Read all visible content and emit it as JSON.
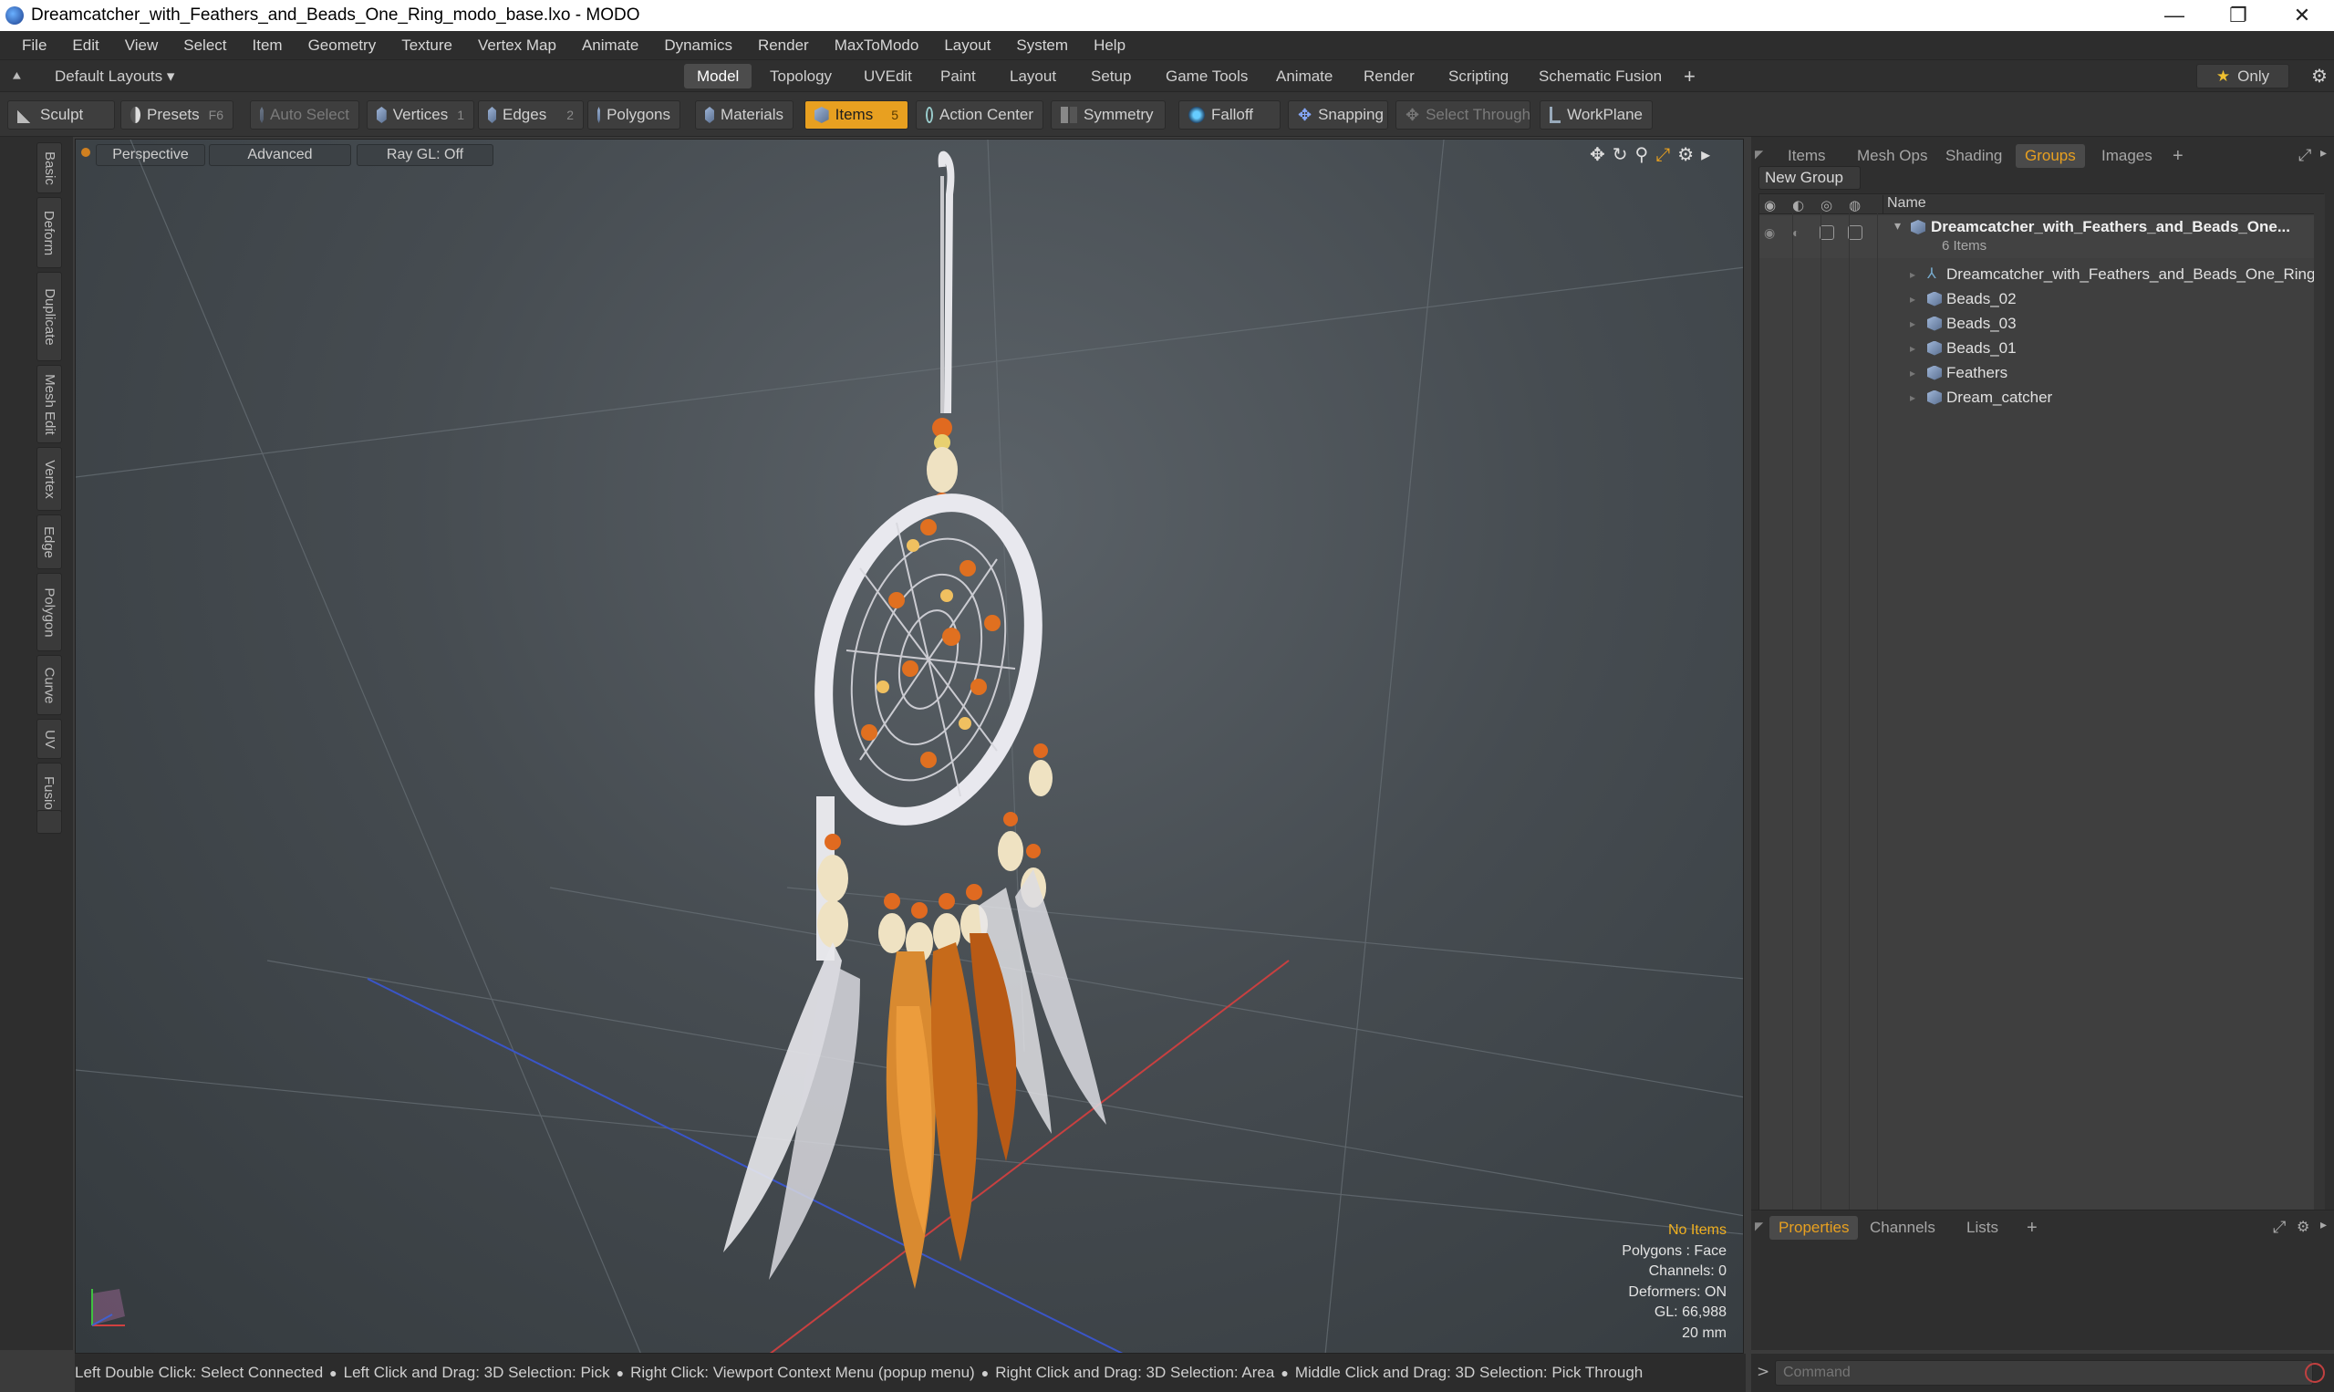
{
  "window": {
    "title": "Dreamcatcher_with_Feathers_and_Beads_One_Ring_modo_base.lxo - MODO",
    "minimize": "—",
    "maximize": "❐",
    "close": "✕"
  },
  "menu": [
    "File",
    "Edit",
    "View",
    "Select",
    "Item",
    "Geometry",
    "Texture",
    "Vertex Map",
    "Animate",
    "Dynamics",
    "Render",
    "MaxToModo",
    "Layout",
    "System",
    "Help"
  ],
  "layout_bar": {
    "layouts_label": "Default Layouts ▾",
    "tabs": [
      "Model",
      "Topology",
      "UVEdit",
      "Paint",
      "Layout",
      "Setup",
      "Game Tools",
      "Animate",
      "Render",
      "Scripting",
      "Schematic Fusion"
    ],
    "active_tab": "Model",
    "add": "+",
    "only_label": "Only",
    "star": "★"
  },
  "toolbar": {
    "sculpt": "Sculpt",
    "presets": "Presets",
    "presets_key": "F6",
    "auto_select": "Auto Select",
    "vertices": "Vertices",
    "vertices_key": "1",
    "edges": "Edges",
    "edges_key": "2",
    "polygons": "Polygons",
    "materials": "Materials",
    "items": "Items",
    "items_key": "5",
    "action_center": "Action Center",
    "symmetry": "Symmetry",
    "falloff": "Falloff",
    "snapping": "Snapping",
    "select_through": "Select Through",
    "workplane": "WorkPlane"
  },
  "left_tabs": [
    "Basic",
    "Deform",
    "Duplicate",
    "Mesh Edit",
    "Vertex",
    "Edge",
    "Polygon",
    "Curve",
    "UV",
    "Fusion"
  ],
  "viewport": {
    "perspective": "Perspective",
    "advanced": "Advanced",
    "raygl": "Ray GL: Off",
    "info": {
      "no_items": "No Items",
      "polygons": "Polygons : Face",
      "channels": "Channels: 0",
      "deformers": "Deformers: ON",
      "gl": "GL: 66,988",
      "scale": "20 mm"
    }
  },
  "right_panel": {
    "tabs": [
      "Items",
      "Mesh Ops",
      "Shading",
      "Groups",
      "Images"
    ],
    "active_tab": "Groups",
    "add": "+",
    "new_group": "New Group",
    "column_name": "Name",
    "group_name": "Dreamcatcher_with_Feathers_and_Beads_One...",
    "group_count": "6 Items",
    "children": [
      "Dreamcatcher_with_Feathers_and_Beads_One_Ring",
      "Beads_02",
      "Beads_03",
      "Beads_01",
      "Feathers",
      "Dream_catcher"
    ]
  },
  "bottom_panel": {
    "tabs": [
      "Properties",
      "Channels",
      "Lists"
    ],
    "active_tab": "Properties",
    "add": "+"
  },
  "statusbar": {
    "hints": [
      "Left Double Click: Select Connected",
      "Left Click and Drag: 3D Selection: Pick",
      "Right Click: Viewport Context Menu (popup menu)",
      "Right Click and Drag: 3D Selection: Area",
      "Middle Click and Drag: 3D Selection: Pick Through"
    ]
  },
  "command": {
    "prompt": ">",
    "placeholder": "Command"
  },
  "colors": {
    "accent": "#e8a020",
    "panel": "#3f3f3f",
    "viewport_top": "#5b6268",
    "viewport_bottom": "#343a3e"
  }
}
